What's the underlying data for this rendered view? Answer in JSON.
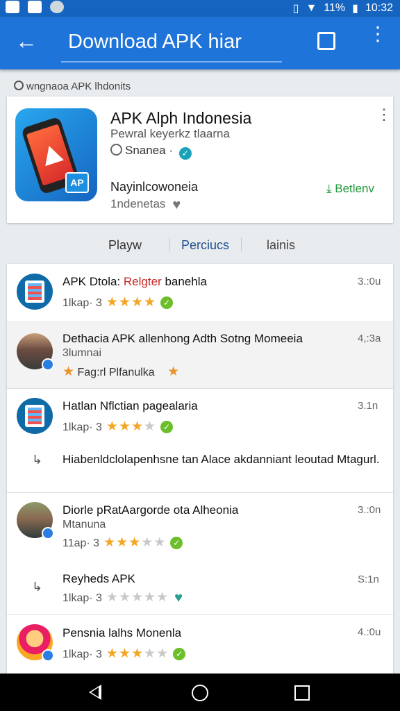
{
  "status": {
    "battery": "11%",
    "time": "10:32"
  },
  "toolbar": {
    "title": "Download APK hiar"
  },
  "breadcrumb": "wngnaoa APK lhdonits",
  "app": {
    "name": "APK Alph Indonesia",
    "subtitle": "Pewral keyerkz tlaarna",
    "developer": "Snanea",
    "icon_badge": "AP",
    "label": "Nayinlcowoneia",
    "meta": "1ndenetas",
    "download_label": "Betlenv"
  },
  "tabs": [
    {
      "label": "Playw"
    },
    {
      "label": "Perciucs"
    },
    {
      "label": "lainis"
    }
  ],
  "list": {
    "items": [
      {
        "title_a": "APK Dtola:",
        "title_b": "Relgter",
        "title_c": "banehla",
        "rating_label": "1lkap· 3",
        "size": "3.:0u"
      },
      {
        "title": "Dethacia APK allenhong Adth Sotng Momeeia",
        "sub": "3lumnai",
        "publisher": "Fag:rl Plfanulka",
        "size": "4,:3a"
      },
      {
        "title": "Hatlan Nflctian pagealaria",
        "rating_label": "1lkap· 3",
        "size": "3.1n"
      },
      {
        "comment": "Hiabenldclolapenhsne tan Alace akdanniant leoutad Mtagurl."
      },
      {
        "title": "Diorle pRatAargorde ota Alheonia",
        "sub": "Mtanuna",
        "rating_label": "11ap· 3",
        "size": "3.:0n"
      },
      {
        "title": "Reyheds APK",
        "rating_label": "1lkap· 3",
        "size": "S:1n"
      },
      {
        "title": "Pensnia lalhs Monenla",
        "rating_label": "1lkap· 3",
        "size": "4.:0u"
      }
    ]
  },
  "colors": {
    "toolbar": "#1e74d8",
    "statusbar": "#1565c0",
    "download": "#1f9a3a",
    "active_tab": "#1f4f8f",
    "star": "#f4a623"
  }
}
